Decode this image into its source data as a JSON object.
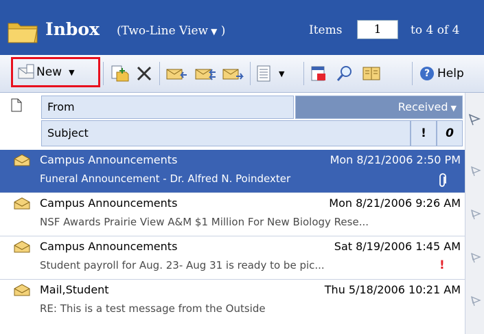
{
  "header": {
    "title": "Inbox",
    "view_mode": "(Two-Line View",
    "view_close": ")",
    "items_label": "Items",
    "items_value": "1",
    "items_range": "to 4 of 4"
  },
  "toolbar": {
    "new_label": "New",
    "help_label": "Help",
    "icons": [
      "new-message-icon",
      "move-to-folder-icon",
      "delete-icon",
      "reply-icon",
      "reply-all-icon",
      "forward-icon",
      "view-options-icon",
      "check-names-icon",
      "find-icon",
      "address-book-icon",
      "help-icon"
    ]
  },
  "columns": {
    "from": "From",
    "received": "Received",
    "subject": "Subject",
    "importance": "!",
    "attachment": "0"
  },
  "messages": [
    {
      "from": "Campus Announcements",
      "received": "Mon 8/21/2006 2:50 PM",
      "subject": "Funeral Announcement - Dr. Alfred N. Poindexter",
      "attachment": true,
      "important": false,
      "selected": true
    },
    {
      "from": "Campus Announcements",
      "received": "Mon 8/21/2006 9:26 AM",
      "subject": "NSF Awards Prairie View A&M $1 Million For New Biology Rese...",
      "attachment": false,
      "important": false,
      "selected": false
    },
    {
      "from": "Campus Announcements",
      "received": "Sat 8/19/2006 1:45 AM",
      "subject": "Student payroll for Aug. 23- Aug 31 is ready to be pic...",
      "attachment": false,
      "important": true,
      "selected": false
    },
    {
      "from": "Mail,Student",
      "received": "Thu 5/18/2006 10:21 AM",
      "subject": "RE: This is a test message from the Outside",
      "attachment": false,
      "important": false,
      "selected": false
    }
  ],
  "colors": {
    "title_bar": "#2a56a8",
    "selected_row": "#3a62b3",
    "highlight_border": "#e8101e",
    "importance": "#e6242c"
  }
}
